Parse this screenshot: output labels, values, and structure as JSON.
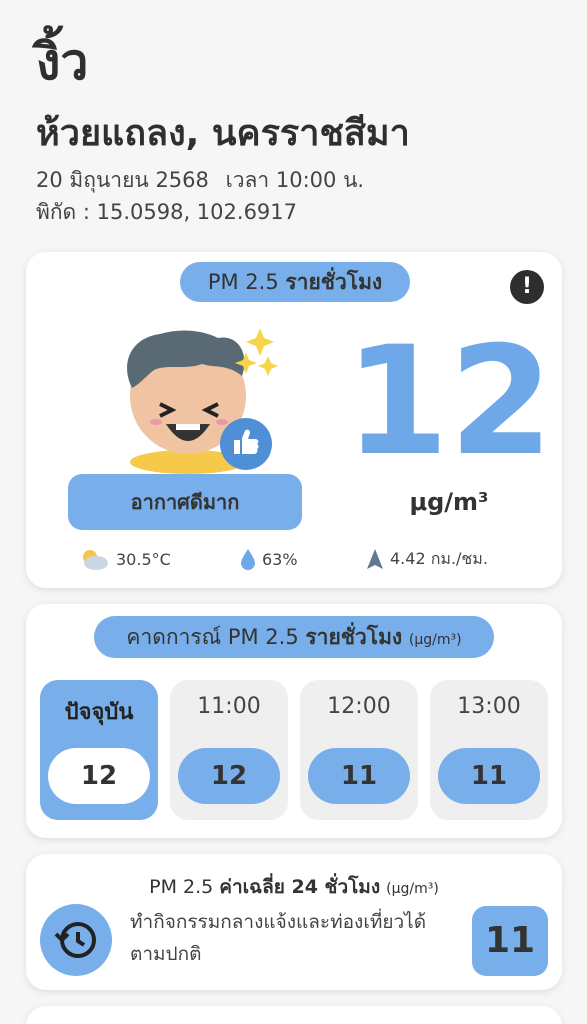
{
  "location": {
    "district": "งิ้ว",
    "area": "ห้วยแถลง, นครราชสีมา",
    "date": "20 มิถุนายน 2568",
    "time": "เวลา 10:00 น.",
    "coords": "พิกัด : 15.0598, 102.6917"
  },
  "current": {
    "pill_prefix": "PM 2.5",
    "pill_bold": "รายชั่วโมง",
    "alert_icon": "!",
    "value": "12",
    "unit": "μg/m³",
    "status": "อากาศดีมาก",
    "temperature": "30.5°C",
    "humidity": "63%",
    "wind": "4.42 กม./ชม."
  },
  "forecast": {
    "pill_prefix": "คาดการณ์ PM 2.5",
    "pill_bold": "รายชั่วโมง",
    "pill_unit": "(μg/m³)",
    "items": [
      {
        "time": "ปัจจุบัน",
        "value": "12"
      },
      {
        "time": "11:00",
        "value": "12"
      },
      {
        "time": "12:00",
        "value": "11"
      },
      {
        "time": "13:00",
        "value": "11"
      }
    ]
  },
  "average": {
    "prefix": "PM 2.5",
    "bold": "ค่าเฉลี่ย 24 ชั่วโมง",
    "unit": "(μg/m³)",
    "advice": "ทำกิจกรรมกลางแจ้งและท่องเที่ยวได้ตามปกติ",
    "value": "11"
  },
  "colors": {
    "accent": "#78aee9",
    "pm_value": "#6fa8e8",
    "card_bg": "#ffffff",
    "page_bg": "#f6f6f6"
  }
}
